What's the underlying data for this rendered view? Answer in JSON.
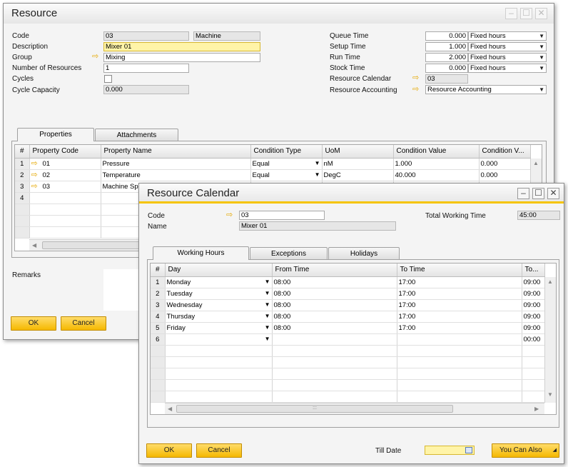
{
  "resource": {
    "title": "Resource",
    "fields": {
      "code_label": "Code",
      "code": "03",
      "type": "Machine",
      "description_label": "Description",
      "description": "Mixer 01",
      "group_label": "Group",
      "group": "Mixing",
      "num_resources_label": "Number of Resources",
      "num_resources": "1",
      "cycles_label": "Cycles",
      "cycle_capacity_label": "Cycle Capacity",
      "cycle_capacity": "0.000",
      "queue_time_label": "Queue Time",
      "queue_time": "0.000",
      "queue_unit": "Fixed hours",
      "setup_time_label": "Setup Time",
      "setup_time": "1.000",
      "setup_unit": "Fixed hours",
      "run_time_label": "Run Time",
      "run_time": "2.000",
      "run_unit": "Fixed hours",
      "stock_time_label": "Stock Time",
      "stock_time": "0.000",
      "stock_unit": "Fixed hours",
      "calendar_label": "Resource Calendar",
      "calendar": "03",
      "accounting_label": "Resource Accounting",
      "accounting": "Resource Accounting"
    },
    "tabs": [
      "Properties",
      "Attachments"
    ],
    "grid": {
      "headers": [
        "#",
        "Property Code",
        "Property Name",
        "Condition Type",
        "UoM",
        "Condition Value",
        "Condition V..."
      ],
      "rows": [
        {
          "num": "1",
          "code": "01",
          "name": "Pressure",
          "ctype": "Equal",
          "uom": "nM",
          "cval": "1.000",
          "cval2": "0.000"
        },
        {
          "num": "2",
          "code": "02",
          "name": "Temperature",
          "ctype": "Equal",
          "uom": "DegC",
          "cval": "40.000",
          "cval2": "0.000"
        },
        {
          "num": "3",
          "code": "03",
          "name": "Machine Sp",
          "ctype": "",
          "uom": "",
          "cval": "",
          "cval2": ""
        },
        {
          "num": "4",
          "code": "",
          "name": "",
          "ctype": "",
          "uom": "",
          "cval": "",
          "cval2": ""
        }
      ]
    },
    "remarks_label": "Remarks",
    "ok": "OK",
    "cancel": "Cancel"
  },
  "calendar": {
    "title": "Resource Calendar",
    "code_label": "Code",
    "code": "03",
    "name_label": "Name",
    "name": "Mixer 01",
    "total_label": "Total Working Time",
    "total": "45:00",
    "tabs": [
      "Working Hours",
      "Exceptions",
      "Holidays"
    ],
    "grid": {
      "headers": [
        "#",
        "Day",
        "From Time",
        "To Time",
        "To..."
      ],
      "rows": [
        {
          "num": "1",
          "day": "Monday",
          "from": "08:00",
          "to": "17:00",
          "to2": "09:00"
        },
        {
          "num": "2",
          "day": "Tuesday",
          "from": "08:00",
          "to": "17:00",
          "to2": "09:00"
        },
        {
          "num": "3",
          "day": "Wednesday",
          "from": "08:00",
          "to": "17:00",
          "to2": "09:00"
        },
        {
          "num": "4",
          "day": "Thursday",
          "from": "08:00",
          "to": "17:00",
          "to2": "09:00"
        },
        {
          "num": "5",
          "day": "Friday",
          "from": "08:00",
          "to": "17:00",
          "to2": "09:00"
        },
        {
          "num": "6",
          "day": "",
          "from": "",
          "to": "",
          "to2": "00:00"
        }
      ]
    },
    "till_date_label": "Till Date",
    "till_date": "",
    "ok": "OK",
    "cancel": "Cancel",
    "you_can_also": "You Can Also"
  },
  "colors": {
    "accent": "#f5c400",
    "link_arrow": "#e5a800",
    "button": "#f5b800"
  },
  "icons": [
    "link-arrow-icon",
    "dropdown-icon",
    "minimize-icon",
    "maximize-icon",
    "close-icon",
    "calendar-icon"
  ]
}
